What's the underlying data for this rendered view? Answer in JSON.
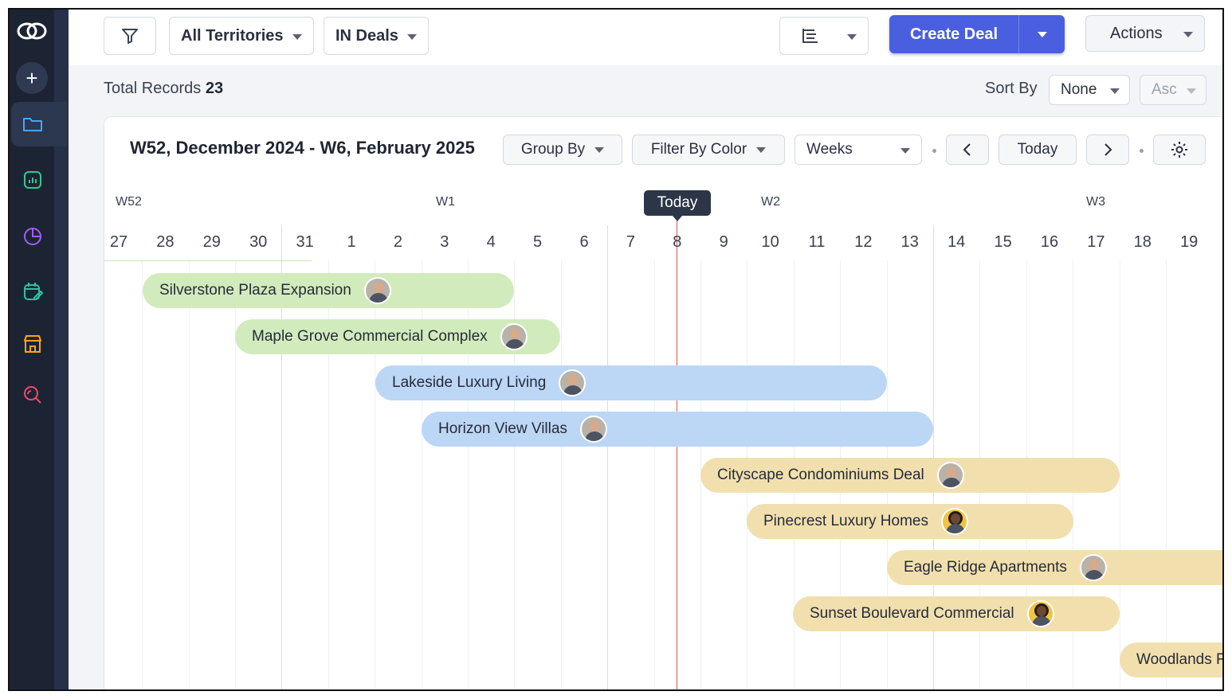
{
  "topbar": {
    "territory": "All Territories",
    "deals_filter": "IN Deals",
    "create_deal": "Create Deal",
    "actions": "Actions"
  },
  "records": {
    "label": "Total Records",
    "count": "23",
    "sort_by_label": "Sort By",
    "sort_field": "None",
    "sort_order": "Asc"
  },
  "timeline": {
    "range_title": "W52, December 2024 - W6, February 2025",
    "group_by": "Group By",
    "filter_by_color": "Filter By Color",
    "view": "Weeks",
    "today_button": "Today",
    "today_tooltip": "Today",
    "weeks": [
      "W52",
      "W1",
      "W2",
      "W3"
    ],
    "days": [
      "27",
      "28",
      "29",
      "30",
      "31",
      "1",
      "2",
      "3",
      "4",
      "5",
      "6",
      "7",
      "8",
      "9",
      "10",
      "11",
      "12",
      "13",
      "14",
      "15",
      "16",
      "17",
      "18",
      "19"
    ]
  },
  "deals": [
    {
      "name": "Silverstone Plaza Expansion",
      "color": "green"
    },
    {
      "name": "Maple Grove Commercial Complex",
      "color": "green"
    },
    {
      "name": "Lakeside Luxury Living",
      "color": "blue"
    },
    {
      "name": "Horizon View Villas",
      "color": "blue"
    },
    {
      "name": "Cityscape Condominiums Deal",
      "color": "yellow"
    },
    {
      "name": "Pinecrest Luxury Homes",
      "color": "yellow"
    },
    {
      "name": "Eagle Ridge Apartments",
      "color": "yellow"
    },
    {
      "name": "Sunset Boulevard Commercial",
      "color": "yellow"
    },
    {
      "name": "Woodlands F",
      "color": "yellow"
    }
  ],
  "colors": {
    "primary": "#4a5fe0",
    "sidebar": "#1c2434",
    "green_bar": "#d2ebbd",
    "blue_bar": "#bcd6f6",
    "yellow_bar": "#f1e0ae",
    "today_line": "#e0544a"
  }
}
